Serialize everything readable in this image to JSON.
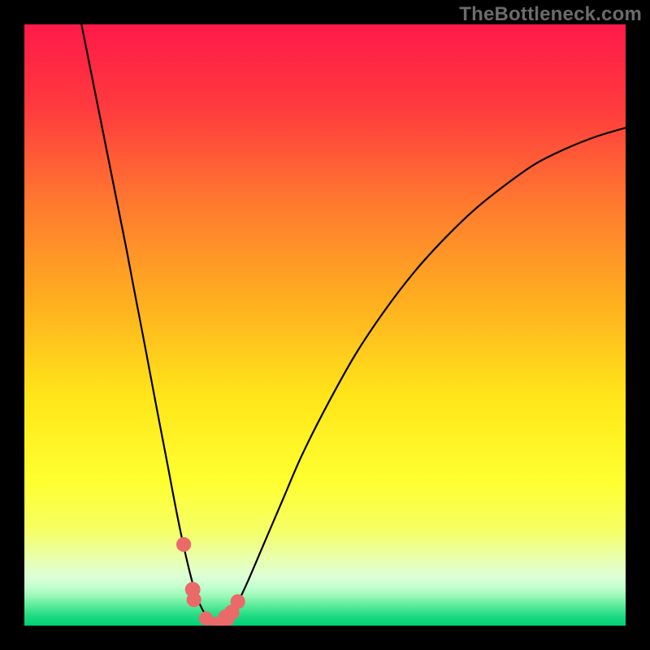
{
  "watermark": "TheBottleneck.com",
  "chart_data": {
    "type": "line",
    "title": "",
    "xlabel": "",
    "ylabel": "",
    "xlim": [
      0,
      100
    ],
    "ylim": [
      0,
      100
    ],
    "series": [
      {
        "name": "bottleneck-curve",
        "x": [
          9.5,
          10,
          11,
          12,
          13,
          14,
          15,
          16,
          17,
          18,
          19,
          20,
          21,
          22,
          23,
          24,
          25,
          26,
          27,
          28,
          29,
          30,
          31,
          32,
          33,
          35,
          37,
          40,
          43,
          46,
          50,
          55,
          60,
          65,
          70,
          75,
          80,
          85,
          90,
          95,
          100
        ],
        "y": [
          100,
          97.5,
          92.5,
          87.5,
          82.5,
          77.5,
          72.5,
          67.5,
          62.5,
          57.2,
          52,
          46.8,
          41.5,
          36.2,
          31,
          25.8,
          20.5,
          15.5,
          11,
          7,
          4,
          2,
          0.8,
          0.3,
          0.8,
          3,
          7,
          14,
          21,
          28,
          36,
          45,
          52.5,
          59,
          64.5,
          69.3,
          73.3,
          76.8,
          79.3,
          81.3,
          82.8
        ]
      }
    ],
    "markers": [
      {
        "x": 26.5,
        "y": 13.5,
        "r": 1.1
      },
      {
        "x": 28.0,
        "y": 6.0,
        "r": 1.2
      },
      {
        "x": 28.2,
        "y": 4.3,
        "r": 1.1
      },
      {
        "x": 30.2,
        "y": 1.2,
        "r": 1.0
      },
      {
        "x": 32.0,
        "y": 0.3,
        "r": 1.0
      },
      {
        "x": 33.6,
        "y": 1.3,
        "r": 1.5
      },
      {
        "x": 34.5,
        "y": 2.2,
        "r": 1.2
      },
      {
        "x": 35.5,
        "y": 4.0,
        "r": 1.1
      }
    ],
    "gradient_stops": [
      {
        "offset": 0.0,
        "color": "#ff1a49"
      },
      {
        "offset": 0.14,
        "color": "#ff3b3e"
      },
      {
        "offset": 0.3,
        "color": "#ff7a2f"
      },
      {
        "offset": 0.47,
        "color": "#ffb21f"
      },
      {
        "offset": 0.62,
        "color": "#ffe61a"
      },
      {
        "offset": 0.76,
        "color": "#ffff30"
      },
      {
        "offset": 0.84,
        "color": "#f6ff63"
      },
      {
        "offset": 0.89,
        "color": "#e8ffb0"
      },
      {
        "offset": 0.918,
        "color": "#dcffd6"
      },
      {
        "offset": 0.935,
        "color": "#c3ffd0"
      },
      {
        "offset": 0.95,
        "color": "#9cf9b8"
      },
      {
        "offset": 0.963,
        "color": "#6aeea0"
      },
      {
        "offset": 0.975,
        "color": "#3de38e"
      },
      {
        "offset": 0.987,
        "color": "#18d87f"
      },
      {
        "offset": 1.0,
        "color": "#00d175"
      }
    ],
    "curve_color": "#000000",
    "marker_color": "#ea6a6a"
  }
}
